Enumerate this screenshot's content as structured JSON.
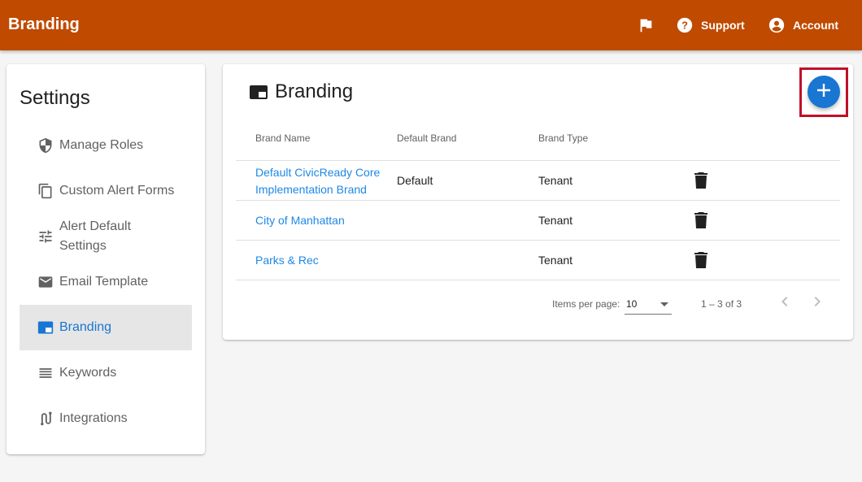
{
  "header": {
    "title": "Branding",
    "support_label": "Support",
    "account_label": "Account",
    "color": "#bf4a00"
  },
  "sidebar": {
    "title": "Settings",
    "items": [
      {
        "label": "Manage Roles",
        "icon": "shield-icon"
      },
      {
        "label": "Custom Alert Forms",
        "icon": "copy-icon"
      },
      {
        "label": "Alert Default Settings",
        "icon": "tune-icon"
      },
      {
        "label": "Email Template",
        "icon": "email-icon"
      },
      {
        "label": "Branding",
        "icon": "branding-icon",
        "active": true
      },
      {
        "label": "Keywords",
        "icon": "list-icon"
      },
      {
        "label": "Integrations",
        "icon": "integration-icon"
      }
    ]
  },
  "main": {
    "title": "Branding",
    "columns": [
      "Brand Name",
      "Default Brand",
      "Brand Type"
    ],
    "rows": [
      {
        "name": "Default CivicReady Core Implementation Brand",
        "default": "Default",
        "type": "Tenant"
      },
      {
        "name": "City of Manhattan",
        "default": "",
        "type": "Tenant"
      },
      {
        "name": "Parks & Rec",
        "default": "",
        "type": "Tenant"
      }
    ],
    "paginator": {
      "items_per_page_label": "Items per page:",
      "page_size": "10",
      "range": "1 – 3 of 3"
    }
  },
  "colors": {
    "accent": "#1976d2",
    "link": "#1e88e5",
    "highlight": "#c0102a"
  }
}
